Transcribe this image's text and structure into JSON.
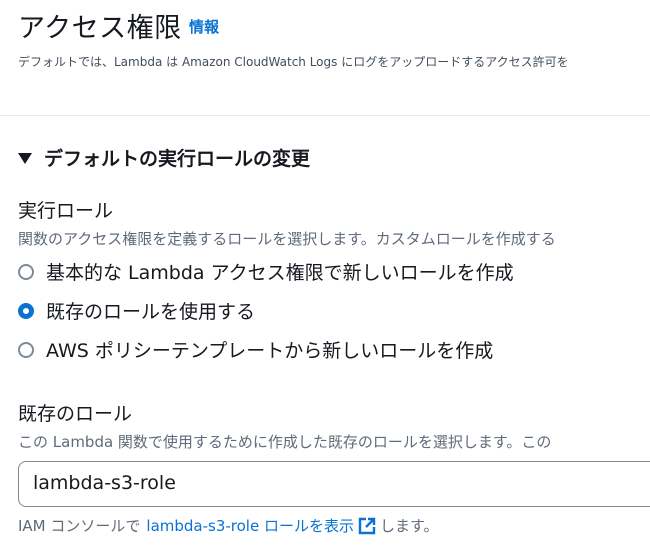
{
  "header": {
    "title": "アクセス権限",
    "info_link": "情報",
    "description": "デフォルトでは、Lambda は Amazon CloudWatch Logs にログをアップロードするアクセス許可を"
  },
  "expander": {
    "label": "デフォルトの実行ロールの変更",
    "icon": "caret-down-icon"
  },
  "execution_role": {
    "label": "実行ロール",
    "description": "関数のアクセス権限を定義するロールを選択します。カスタムロールを作成する",
    "options": [
      {
        "label": "基本的な Lambda アクセス権限で新しいロールを作成",
        "selected": false
      },
      {
        "label": "既存のロールを使用する",
        "selected": true
      },
      {
        "label": "AWS ポリシーテンプレートから新しいロールを作成",
        "selected": false
      }
    ]
  },
  "existing_role": {
    "label": "既存のロール",
    "description": "この Lambda 関数で使用するために作成した既存のロールを選択します。この",
    "value": "lambda-s3-role",
    "helper_prefix": "IAM コンソールで",
    "helper_link": "lambda-s3-role ロールを表示",
    "helper_suffix": "します。",
    "link_icon": "external-link-icon"
  },
  "colors": {
    "accent": "#0972d3",
    "text": "#16191f",
    "secondary_text": "#5f6b7a",
    "border": "#7d8998"
  }
}
